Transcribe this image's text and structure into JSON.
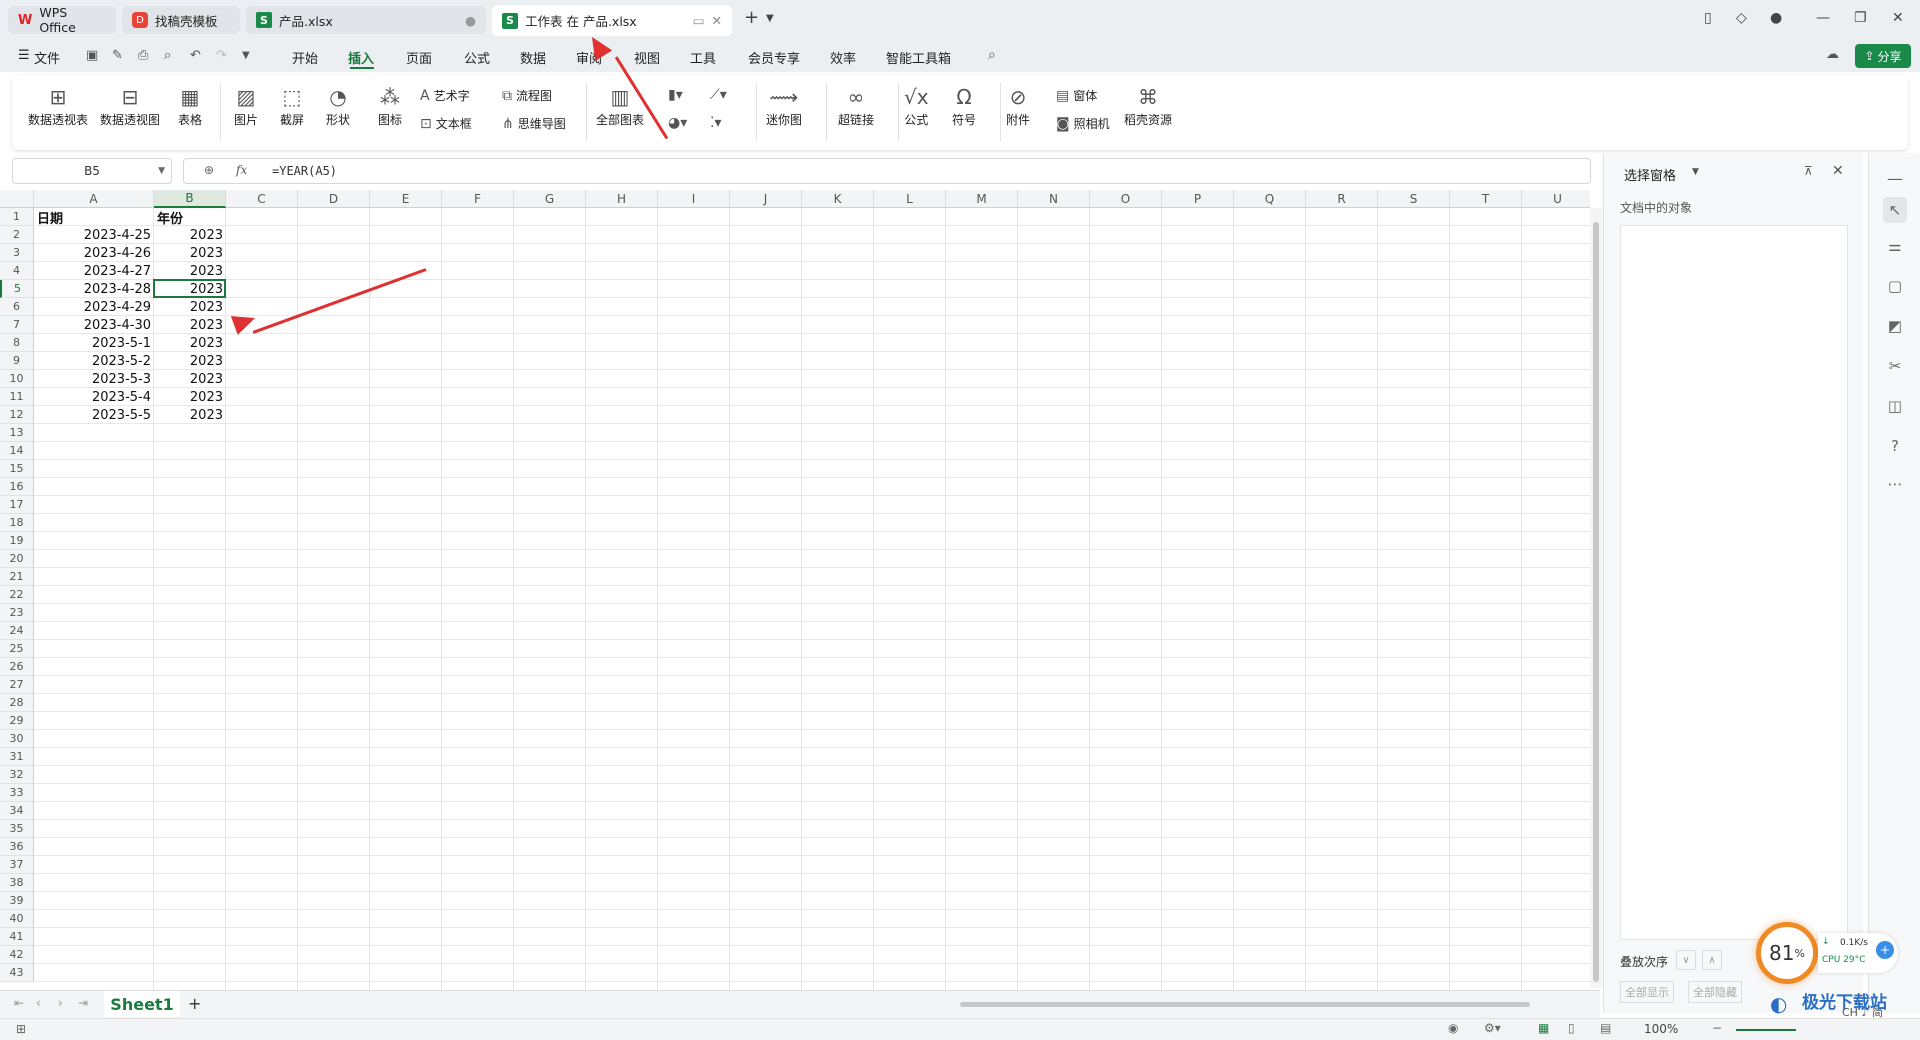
{
  "tabs": [
    {
      "label": "WPS Office",
      "icon": "wps-logo-icon"
    },
    {
      "label": "找稿壳模板",
      "icon": "docer-icon"
    },
    {
      "label": "产品.xlsx",
      "icon": "spreadsheet-icon"
    },
    {
      "label": "工作表 在 产品.xlsx",
      "icon": "spreadsheet-icon",
      "active": true
    }
  ],
  "menu": {
    "file": "文件",
    "items": [
      "开始",
      "插入",
      "页面",
      "公式",
      "数据",
      "审阅",
      "视图",
      "工具",
      "会员专享",
      "效率",
      "智能工具箱"
    ],
    "active": "插入",
    "share": "分享"
  },
  "ribbon": {
    "pivot_table": "数据透视表",
    "pivot_chart": "数据透视图",
    "table": "表格",
    "picture": "图片",
    "screenshot": "截屏",
    "shape": "形状",
    "icon": "图标",
    "wordart": "艺术字",
    "textbox": "文本框",
    "flowchart": "流程图",
    "mindmap": "思维导图",
    "all_charts": "全部图表",
    "sparkline": "迷你图",
    "hyperlink": "超链接",
    "formula": "公式",
    "symbol": "符号",
    "attachment": "附件",
    "form": "窗体",
    "camera": "照相机",
    "resources": "稻壳资源"
  },
  "formula_bar": {
    "name_box": "B5",
    "fx": "fx",
    "formula": "=YEAR(A5)"
  },
  "columns": [
    "A",
    "B",
    "C",
    "D",
    "E",
    "F",
    "G",
    "H",
    "I",
    "J",
    "K",
    "L",
    "M",
    "N",
    "O",
    "P",
    "Q",
    "R",
    "S",
    "T",
    "U"
  ],
  "selected_column": "B",
  "selected_row": 5,
  "header_row": {
    "A": "日期",
    "B": "年份"
  },
  "data_rows": [
    {
      "A": "2023-4-25",
      "B": "2023"
    },
    {
      "A": "2023-4-26",
      "B": "2023"
    },
    {
      "A": "2023-4-27",
      "B": "2023"
    },
    {
      "A": "2023-4-28",
      "B": "2023"
    },
    {
      "A": "2023-4-29",
      "B": "2023"
    },
    {
      "A": "2023-4-30",
      "B": "2023"
    },
    {
      "A": "2023-5-1",
      "B": "2023"
    },
    {
      "A": "2023-5-2",
      "B": "2023"
    },
    {
      "A": "2023-5-3",
      "B": "2023"
    },
    {
      "A": "2023-5-4",
      "B": "2023"
    },
    {
      "A": "2023-5-5",
      "B": "2023"
    }
  ],
  "row_count": 43,
  "sheet": {
    "name": "Sheet1",
    "add": "+"
  },
  "panel": {
    "title": "选择窗格",
    "subtitle": "文档中的对象",
    "order_label": "叠放次序",
    "show_all": "全部显示",
    "hide_all": "全部隐藏"
  },
  "status": {
    "zoom": "100%"
  },
  "overlay": {
    "gauge": "81",
    "gauge_unit": "%",
    "net": "0.1K/s",
    "cpu": "CPU 29°C",
    "ime": "CH ♪ 简",
    "watermark": "极光下载站"
  },
  "colors": {
    "accent": "#1a7a3e",
    "arrow": "#e03030"
  }
}
